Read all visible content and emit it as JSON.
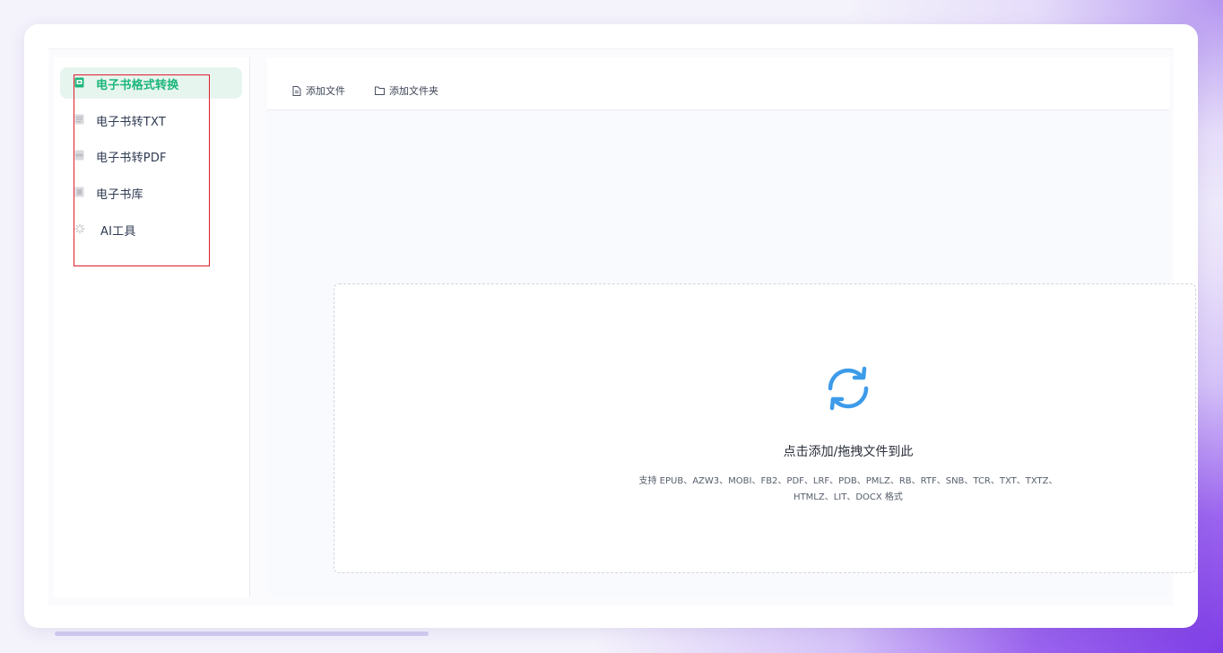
{
  "sidebar": {
    "items": [
      {
        "label": "电子书格式转换",
        "icon": "ebook-convert-icon",
        "active": true
      },
      {
        "label": "电子书转TXT",
        "icon": "book-txt-icon",
        "active": false
      },
      {
        "label": "电子书转PDF",
        "icon": "book-pdf-icon",
        "active": false
      },
      {
        "label": "电子书库",
        "icon": "book-library-icon",
        "active": false
      },
      {
        "label": "AI工具",
        "icon": "ai-sparkle-icon",
        "active": false
      }
    ]
  },
  "toolbar": {
    "add_file_label": "添加文件",
    "add_folder_label": "添加文件夹"
  },
  "dropzone": {
    "title": "点击添加/拖拽文件到此",
    "formats_line1": "支持 EPUB、AZW3、MOBI、FB2、PDF、LRF、PDB、PMLZ、RB、RTF、SNB、TCR、TXT、TXTZ、",
    "formats_line2": "HTMLZ、LIT、DOCX 格式",
    "icon": "refresh-icon"
  },
  "colors": {
    "accent_green": "#1bb67a",
    "accent_blue": "#3d9be9",
    "highlight_red": "#e01e2a"
  }
}
